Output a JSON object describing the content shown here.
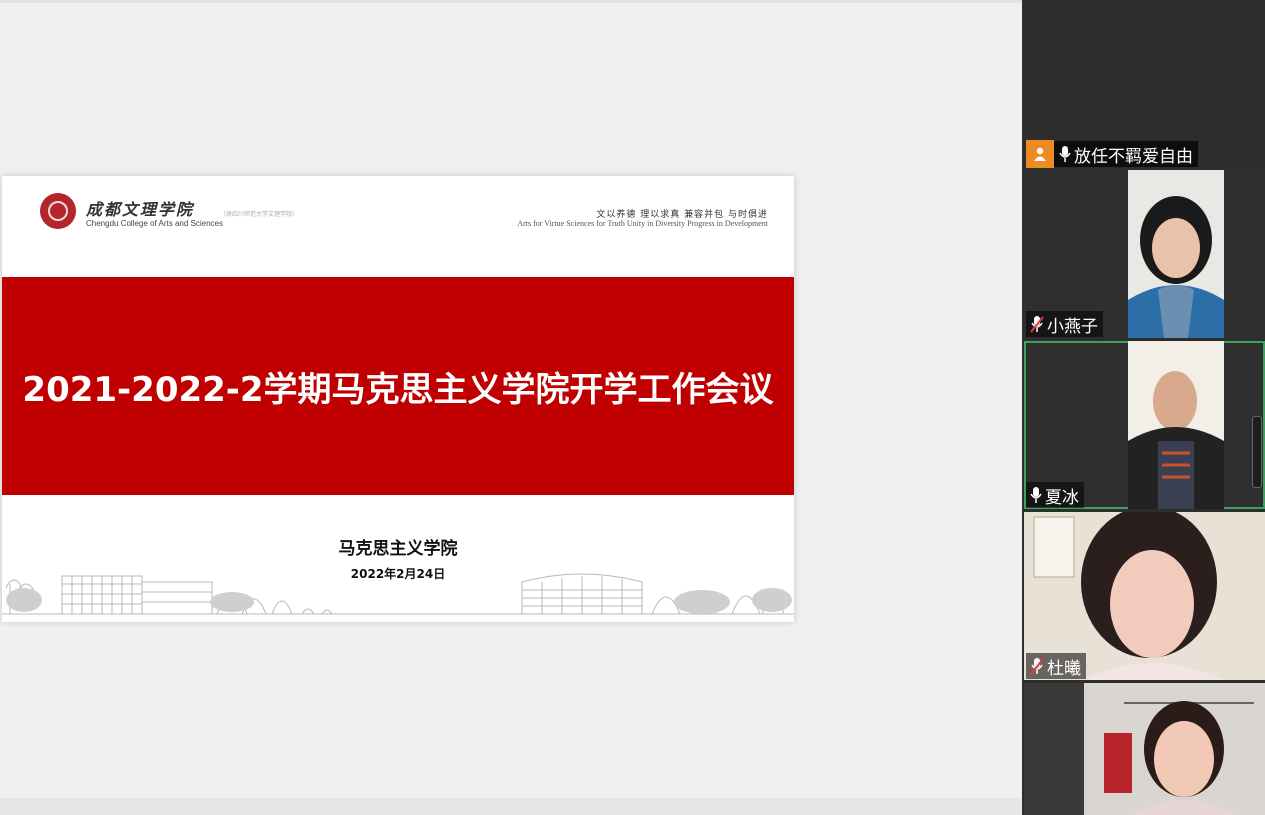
{
  "slide": {
    "logo_cn": "成都文理学院",
    "logo_en": "Chengdu College of Arts and Sciences",
    "logo_sub": "（原四川师范大学文理学院）",
    "motto_cn": "文以养德  理以求真  兼容并包  与时俱进",
    "motto_en": "Arts for Virtue   Sciences for Truth   Unity in Diversity   Progress in Development",
    "title": "2021-2022-2学期马克思主义学院开学工作会议",
    "department": "马克思主义学院",
    "date": "2022年2月24日"
  },
  "sidebar": {
    "collapse_icon": "chevron-up-icon",
    "volume_level": 0.42,
    "participants": [
      {
        "name": "放任不羁爱自由",
        "mic": "on",
        "role": "host",
        "video": false
      },
      {
        "name": "小燕子",
        "mic": "muted",
        "video": true
      },
      {
        "name": "夏冰",
        "mic": "on",
        "video": true,
        "speaking": true
      },
      {
        "name": "杜曦",
        "mic": "muted",
        "video": true
      },
      {
        "name": "",
        "mic": "",
        "video": true
      }
    ]
  },
  "colors": {
    "slide_red": "#c00000",
    "host_badge": "#f08a24",
    "active_border": "#3aa35c",
    "sidebar_bg": "#2d2d2d"
  }
}
